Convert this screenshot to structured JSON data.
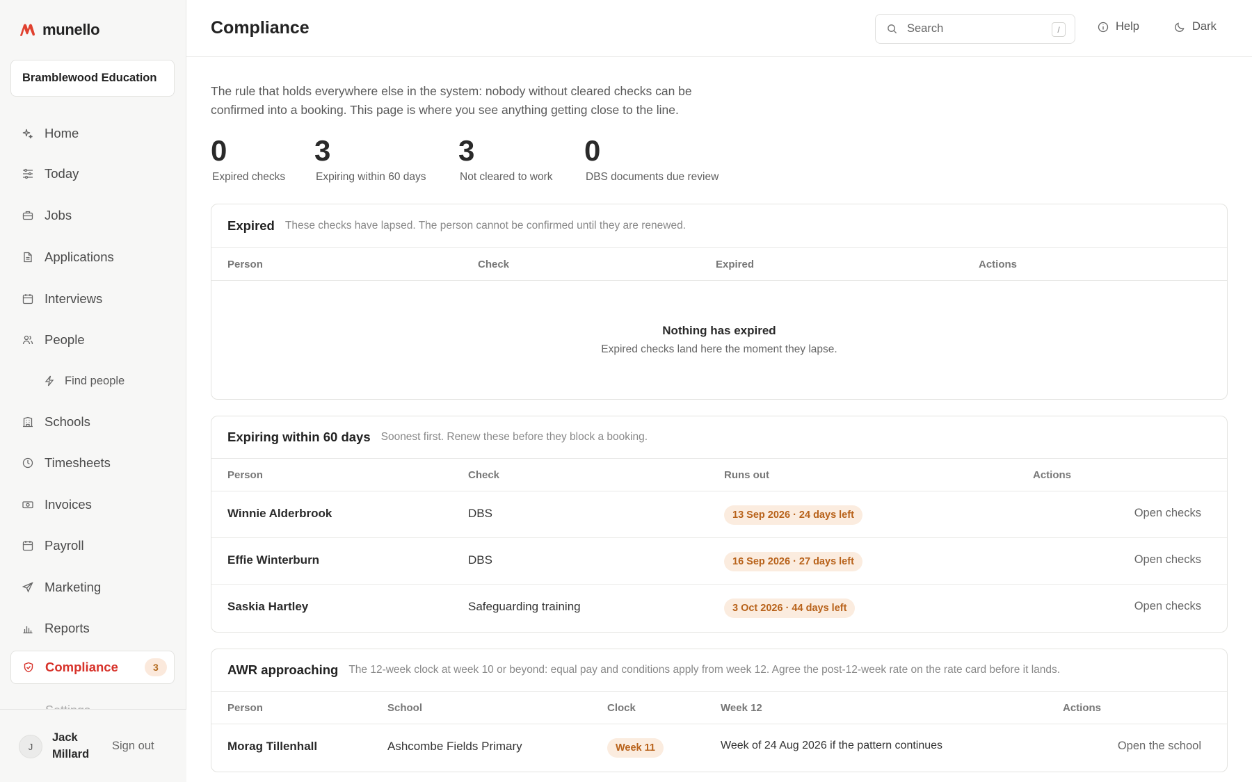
{
  "brand": {
    "name": "munello",
    "accent": "#e0412f"
  },
  "org": {
    "name": "Bramblewood Education"
  },
  "nav": {
    "items": [
      {
        "label": "Home",
        "icon": "sparkle-icon"
      },
      {
        "label": "Today",
        "icon": "sliders-icon"
      },
      {
        "label": "Jobs",
        "icon": "briefcase-icon"
      },
      {
        "label": "Applications",
        "icon": "document-icon"
      },
      {
        "label": "Interviews",
        "icon": "calendar-icon"
      },
      {
        "label": "People",
        "icon": "users-icon"
      },
      {
        "label": "Find people",
        "icon": "bolt-icon",
        "sub": true
      },
      {
        "label": "Schools",
        "icon": "building-icon"
      },
      {
        "label": "Timesheets",
        "icon": "clock-icon"
      },
      {
        "label": "Invoices",
        "icon": "banknote-icon"
      },
      {
        "label": "Payroll",
        "icon": "calendar-icon"
      },
      {
        "label": "Marketing",
        "icon": "send-icon"
      },
      {
        "label": "Reports",
        "icon": "bar-chart-icon"
      },
      {
        "label": "Compliance",
        "icon": "shield-icon",
        "active": true,
        "badge": "3"
      }
    ],
    "partial_item": "Settings"
  },
  "user": {
    "initial": "J",
    "name": "Jack Millard",
    "sign_out": "Sign out"
  },
  "header": {
    "title": "Compliance",
    "search_placeholder": "Search",
    "search_shortcut": "/",
    "help": "Help",
    "theme": "Dark"
  },
  "intro": "The rule that holds everywhere else in the system: nobody without cleared checks can be confirmed into a booking. This page is where you see anything getting close to the line.",
  "stats": [
    {
      "value": "0",
      "label": "Expired checks"
    },
    {
      "value": "3",
      "label": "Expiring within 60 days"
    },
    {
      "value": "3",
      "label": "Not cleared to work"
    },
    {
      "value": "0",
      "label": "DBS documents due review"
    }
  ],
  "expired": {
    "title": "Expired",
    "description": "These checks have lapsed. The person cannot be confirmed until they are renewed.",
    "columns": [
      "Person",
      "Check",
      "Expired",
      "Actions"
    ],
    "empty_title": "Nothing has expired",
    "empty_sub": "Expired checks land here the moment they lapse."
  },
  "expiring": {
    "title": "Expiring within 60 days",
    "description": "Soonest first. Renew these before they block a booking.",
    "columns": [
      "Person",
      "Check",
      "Runs out",
      "Actions"
    ],
    "rows": [
      {
        "person": "Winnie Alderbrook",
        "check": "DBS",
        "runs_out": "13 Sep 2026 · 24 days left",
        "action": "Open checks"
      },
      {
        "person": "Effie Winterburn",
        "check": "DBS",
        "runs_out": "16 Sep 2026 · 27 days left",
        "action": "Open checks"
      },
      {
        "person": "Saskia Hartley",
        "check": "Safeguarding training",
        "runs_out": "3 Oct 2026 · 44 days left",
        "action": "Open checks"
      }
    ]
  },
  "awr": {
    "title": "AWR approaching",
    "description": "The 12-week clock at week 10 or beyond: equal pay and conditions apply from week 12. Agree the post-12-week rate on the rate card before it lands.",
    "columns": [
      "Person",
      "School",
      "Clock",
      "Week 12",
      "Actions"
    ],
    "rows": [
      {
        "person": "Morag Tillenhall",
        "school": "Ashcombe Fields Primary",
        "clock": "Week 11",
        "week12": "Week of 24 Aug 2026 if the pattern continues",
        "action": "Open the school"
      }
    ]
  }
}
